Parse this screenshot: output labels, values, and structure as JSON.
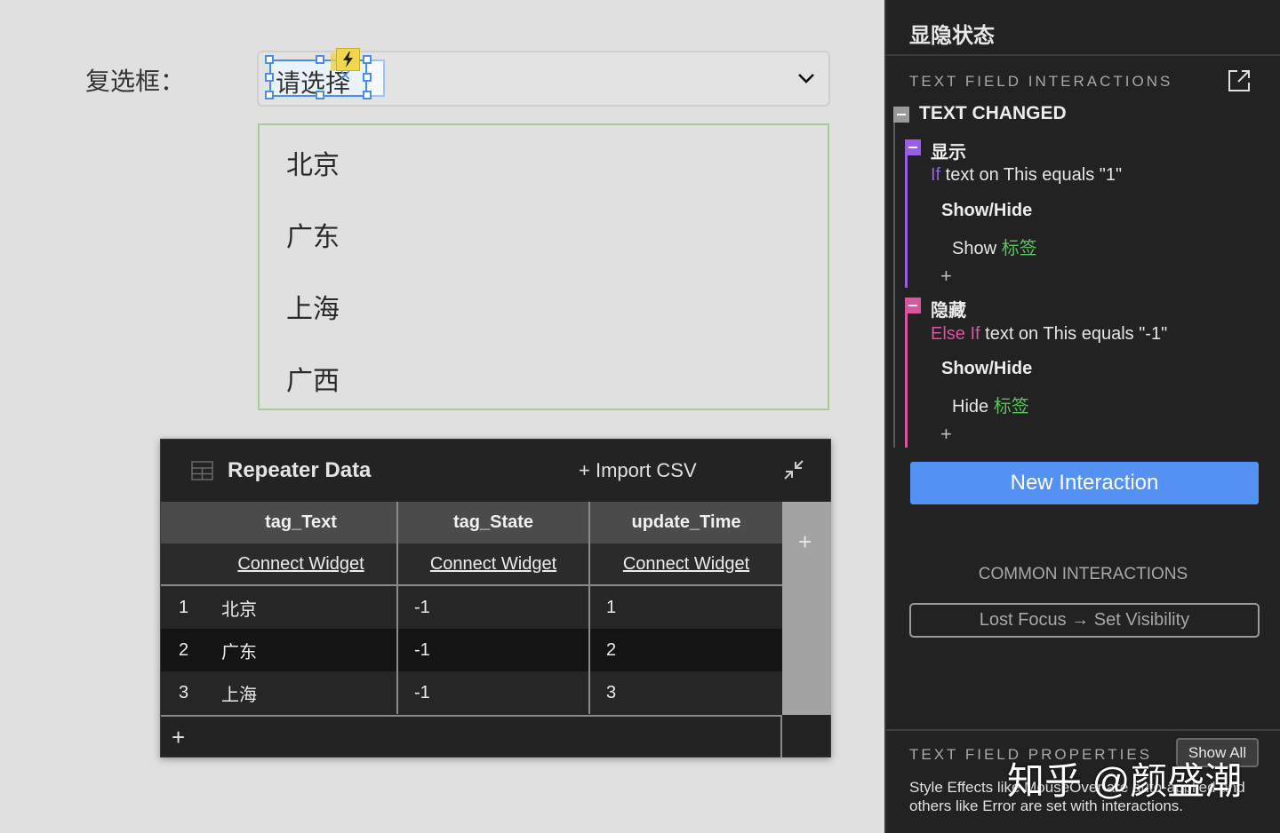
{
  "canvas": {
    "field_label": "复选框：",
    "select": {
      "placeholder": "请选择",
      "clear_icon": "×",
      "chevron": "chevron-down-icon"
    },
    "options": [
      "北京",
      "广东",
      "上海",
      "广西"
    ]
  },
  "repeater": {
    "title": "Repeater Data",
    "import_label": "+ Import CSV",
    "columns": [
      "tag_Text",
      "tag_State",
      "update_Time"
    ],
    "connect_label": "Connect Widget",
    "rows": [
      {
        "index": "1",
        "tag_Text": "北京",
        "tag_State": "-1",
        "update_Time": "1"
      },
      {
        "index": "2",
        "tag_Text": "广东",
        "tag_State": "-1",
        "update_Time": "2"
      },
      {
        "index": "3",
        "tag_Text": "上海",
        "tag_State": "-1",
        "update_Time": "3"
      }
    ],
    "add_column": "+",
    "add_row": "+"
  },
  "panel": {
    "title": "显隐状态",
    "interactions_heading": "TEXT FIELD INTERACTIONS",
    "event": "TEXT CHANGED",
    "cases": [
      {
        "name": "显示",
        "keyword": "If",
        "condition": " text on This equals \"1\"",
        "action_title": "Show/Hide",
        "action_verb": "Show ",
        "action_target": "标签",
        "color": "#9b5de5"
      },
      {
        "name": "隐藏",
        "keyword": "Else If",
        "condition": " text on This equals \"-1\"",
        "action_title": "Show/Hide",
        "action_verb": "Hide ",
        "action_target": "标签",
        "color": "#d9559f"
      }
    ],
    "add_action": "+",
    "new_interaction": "New Interaction",
    "common_heading": "COMMON INTERACTIONS",
    "common_button": "Lost Focus → Set Visibility",
    "props_heading": "TEXT FIELD PROPERTIES",
    "show_all": "Show All",
    "props_desc": "Style Effects like MouseOver are auto-applied and others like Error are set with interactions.",
    "watermark": "知乎 @颜盛潮"
  },
  "colors": {
    "accent_blue": "#5391f5",
    "target_green": "#5cc35c",
    "case1_purple": "#9b5de5",
    "case2_pink": "#d9559f"
  }
}
